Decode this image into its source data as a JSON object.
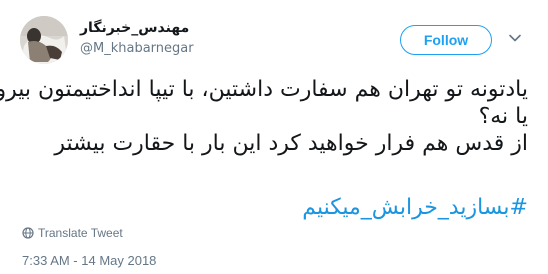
{
  "tweet": {
    "author_name": "مهندس_خبرنگار",
    "author_handle": "@M_khabarnegar",
    "follow_label": "Follow",
    "body_lines": [
      "یادتونه تو تهران هم سفارت داشتین، با تیپا انداختیمتون بیرون",
      "یا نه؟",
      "از قدس هم فرار خواهید کرد این بار با حقارت بیشتر"
    ],
    "hashtag": "#بسازید_خرابش_میکنیم",
    "translate_label": "Translate Tweet",
    "timestamp": "7:33 AM - 14 May 2018"
  },
  "colors": {
    "accent": "#1da1f2",
    "hashtag": "#1b95e0",
    "muted": "#657786",
    "text": "#14171a"
  },
  "icons": {
    "avatar": "avatar-photo",
    "caret": "chevron-down-icon",
    "translate": "globe-icon"
  }
}
